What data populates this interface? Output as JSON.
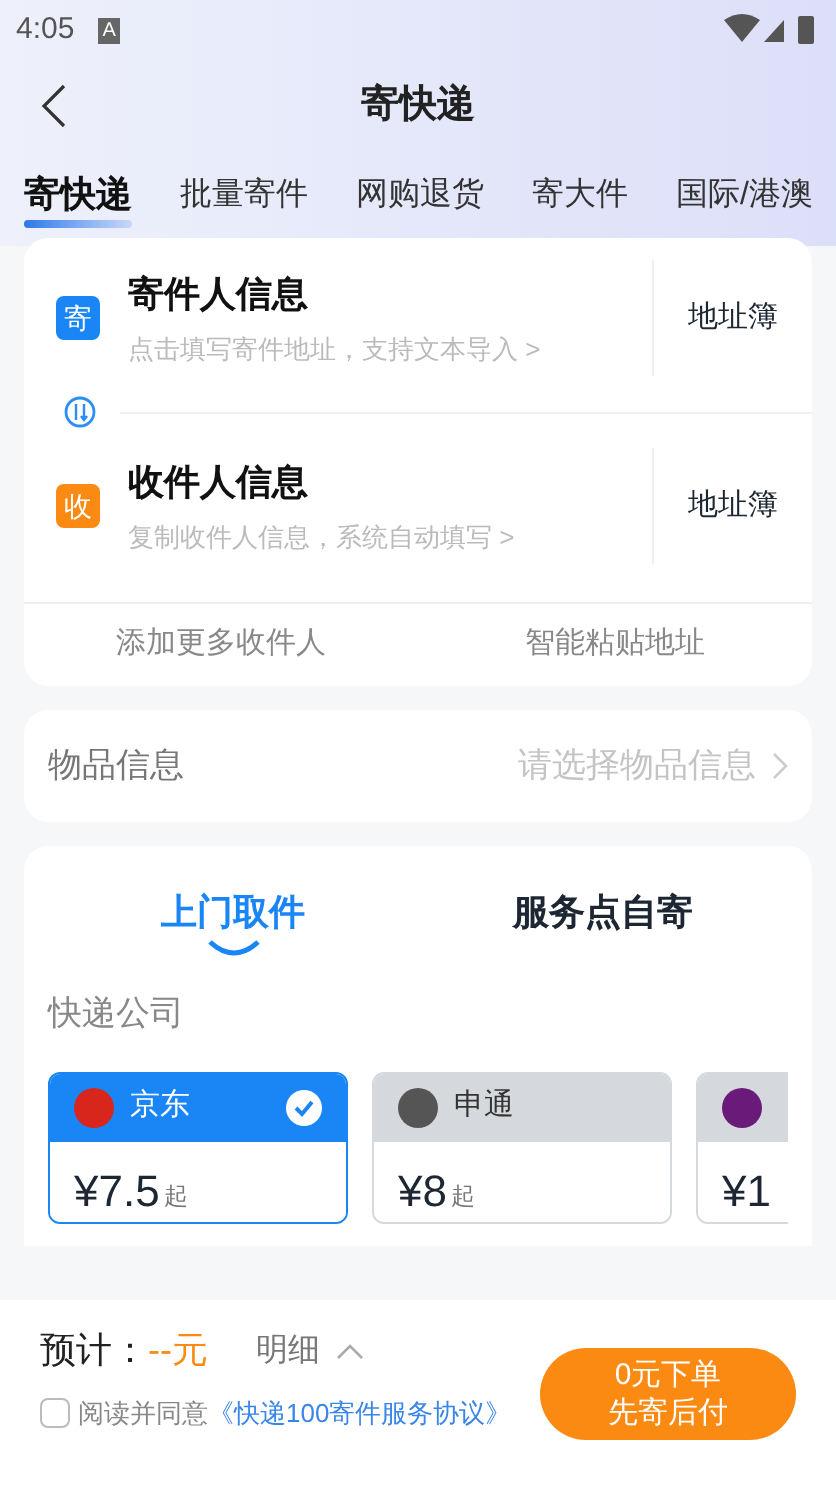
{
  "status_bar": {
    "time": "4:05",
    "notification": "A"
  },
  "header": {
    "title": "寄快递"
  },
  "tabs": [
    {
      "label": "寄快递",
      "selected": true
    },
    {
      "label": "批量寄件",
      "selected": false
    },
    {
      "label": "网购退货",
      "selected": false
    },
    {
      "label": "寄大件",
      "selected": false
    },
    {
      "label": "国际/港澳",
      "selected": false
    }
  ],
  "parties": [
    {
      "badge": "寄",
      "color": "#1a86f5",
      "title": "寄件人信息",
      "hint": "点击填写寄件地址，支持文本导入 >",
      "action": "地址簿"
    },
    {
      "badge": "收",
      "color": "#fb8a13",
      "title": "收件人信息",
      "hint": "复制收件人信息，系统自动填写 >",
      "action": "地址簿"
    }
  ],
  "extra_actions": [
    "添加更多收件人",
    "智能粘贴地址"
  ],
  "goods": {
    "label": "物品信息",
    "placeholder": "请选择物品信息"
  },
  "methods": [
    {
      "label": "上门取件",
      "selected": true
    },
    {
      "label": "服务点自寄",
      "selected": false
    }
  ],
  "carrier_section": "快递公司",
  "carriers": [
    {
      "name": "京东",
      "price": "¥7.5",
      "suffix": "起",
      "selected": true,
      "color": "#d9261c"
    },
    {
      "name": "申通",
      "price": "¥8",
      "suffix": "起",
      "selected": false,
      "color": "#555555"
    },
    {
      "price": "¥1",
      "selected": false,
      "color": "#6a1b7a"
    }
  ],
  "footer": {
    "estimate_label": "预计：",
    "estimate_value": "--元",
    "detail": "明细",
    "agree_checked": false,
    "agree_text": "阅读并同意",
    "agree_link": "《快递100寄件服务协议》",
    "button_line1": "0元下单",
    "button_line2": "先寄后付"
  }
}
